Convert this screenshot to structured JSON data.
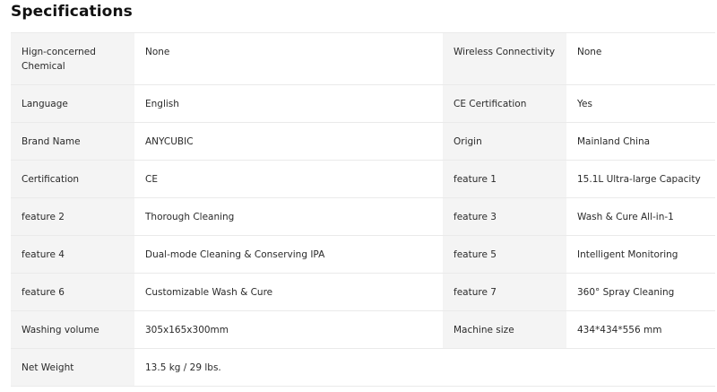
{
  "title": "Specifications",
  "rows": [
    [
      {
        "k": "Hign-concerned Chemical",
        "v": "None"
      },
      {
        "k": "Wireless Connectivity",
        "v": "None"
      }
    ],
    [
      {
        "k": "Language",
        "v": "English"
      },
      {
        "k": "CE Certification",
        "v": "Yes"
      }
    ],
    [
      {
        "k": "Brand Name",
        "v": "ANYCUBIC"
      },
      {
        "k": "Origin",
        "v": "Mainland China"
      }
    ],
    [
      {
        "k": "Certification",
        "v": "CE"
      },
      {
        "k": "feature 1",
        "v": "15.1L Ultra-large Capacity"
      }
    ],
    [
      {
        "k": "feature 2",
        "v": "Thorough Cleaning"
      },
      {
        "k": "feature 3",
        "v": "Wash & Cure All-in-1"
      }
    ],
    [
      {
        "k": "feature 4",
        "v": "Dual-mode Cleaning & Conserving IPA"
      },
      {
        "k": "feature 5",
        "v": "Intelligent Monitoring"
      }
    ],
    [
      {
        "k": "feature 6",
        "v": "Customizable Wash & Cure"
      },
      {
        "k": "feature 7",
        "v": "360° Spray Cleaning"
      }
    ],
    [
      {
        "k": "Washing volume",
        "v": "305x165x300mm"
      },
      {
        "k": "Machine size",
        "v": "434*434*556 mm"
      }
    ],
    [
      {
        "k": "Net Weight",
        "v": "13.5 kg / 29 lbs."
      },
      {
        "k": "",
        "v": ""
      }
    ]
  ]
}
